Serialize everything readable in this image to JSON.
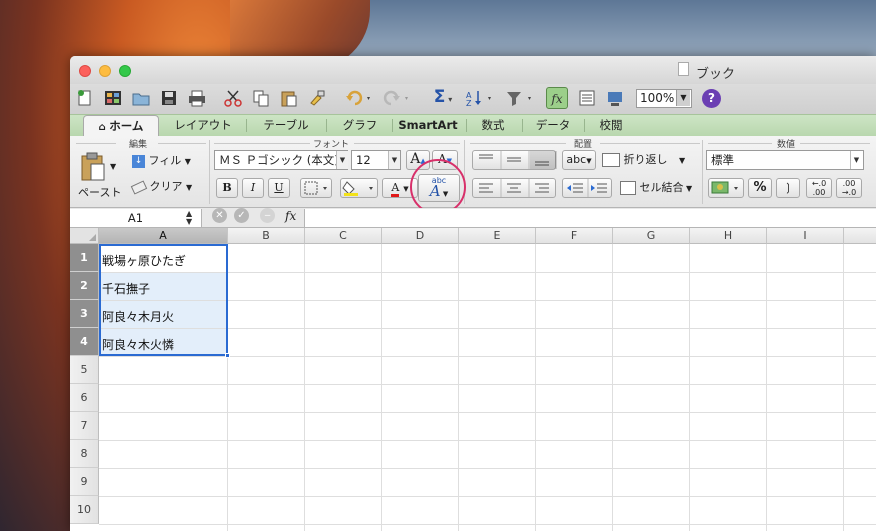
{
  "window": {
    "title": "ブック",
    "zoom": "100%"
  },
  "tabs": [
    "ホーム",
    "レイアウト",
    "テーブル",
    "グラフ",
    "SmartArt",
    "数式",
    "データ",
    "校閲"
  ],
  "groups": {
    "edit": "編集",
    "font": "フォント",
    "align": "配置",
    "number": "数値"
  },
  "edit": {
    "paste": "ペースト",
    "fill": "フィル",
    "clear": "クリア"
  },
  "font": {
    "name": "ＭＳ Ｐゴシック (本文)",
    "size": "12",
    "grow": "A",
    "shrink": "A",
    "bold": "B",
    "italic": "I",
    "underline": "U",
    "font_color": "A",
    "style_abc": "abc"
  },
  "align": {
    "wrap": "折り返し",
    "merge": "セル結合",
    "abc": "abc"
  },
  "number": {
    "format": "標準",
    "percent": "%",
    "comma": "❯",
    "inc": "←.0\n.00",
    "dec": ".00\n→.0"
  },
  "formula": {
    "cell_ref": "A1",
    "fx": "fx"
  },
  "columns": [
    "A",
    "B",
    "C",
    "D",
    "E",
    "F",
    "G",
    "H",
    "I"
  ],
  "rows": [
    "1",
    "2",
    "3",
    "4",
    "5",
    "6",
    "7",
    "8",
    "9",
    "10"
  ],
  "cells": [
    "戦場ヶ原ひたぎ",
    "千石撫子",
    "阿良々木月火",
    "阿良々木火憐"
  ],
  "colors": {
    "ribbon_green": "#b9d7ae",
    "selection": "#2a6ad2",
    "annotation": "#d8306a",
    "help": "#6b3fb3"
  }
}
